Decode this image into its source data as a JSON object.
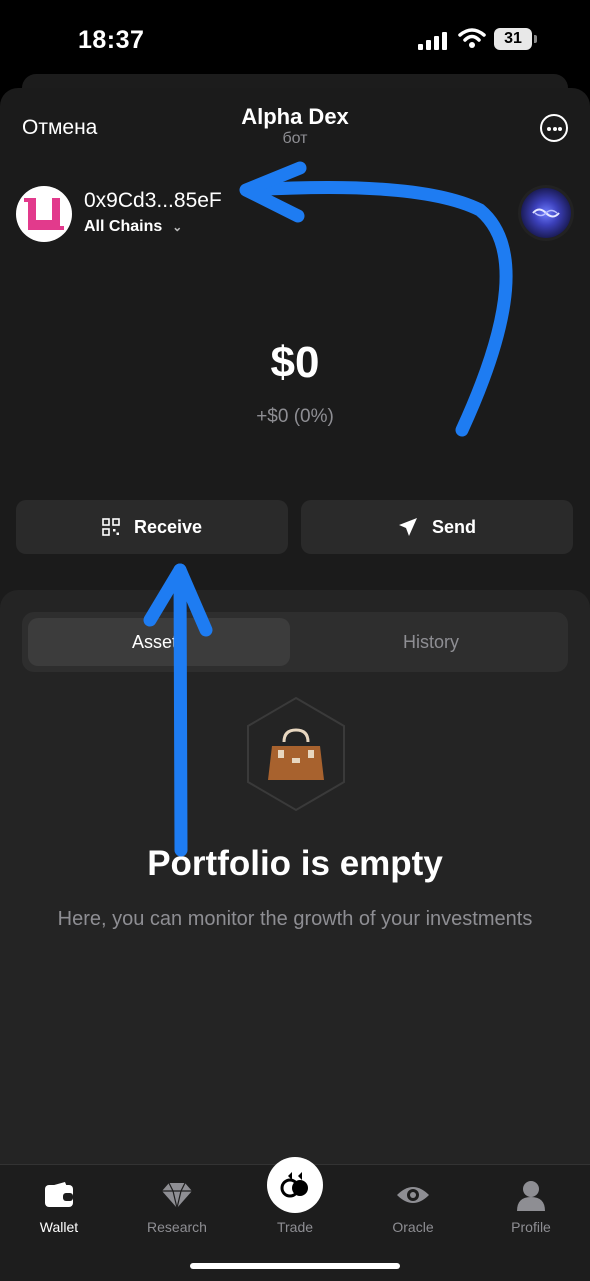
{
  "status_bar": {
    "time": "18:37",
    "battery": "31"
  },
  "header": {
    "cancel_label": "Отмена",
    "title": "Alpha Dex",
    "subtitle": "бот"
  },
  "wallet": {
    "address": "0x9Cd3...85eF",
    "chain_selector": "All Chains",
    "balance": "$0",
    "change": "+$0 (0%)"
  },
  "actions": {
    "receive_label": "Receive",
    "send_label": "Send"
  },
  "tabs": [
    {
      "label": "Assets"
    },
    {
      "label": "History"
    }
  ],
  "empty_state": {
    "title": "Portfolio is empty",
    "description": "Here, you can monitor the growth of your investments"
  },
  "bottom_nav": [
    {
      "label": "Wallet",
      "icon": "wallet-icon"
    },
    {
      "label": "Research",
      "icon": "diamond-icon"
    },
    {
      "label": "Trade",
      "icon": "trade-icon"
    },
    {
      "label": "Oracle",
      "icon": "eye-icon"
    },
    {
      "label": "Profile",
      "icon": "person-icon"
    }
  ],
  "colors": {
    "annotation_arrow": "#1e7cf2",
    "avatar_accent": "#e23a8c",
    "background": "#1b1b1b",
    "panel": "#242424"
  }
}
